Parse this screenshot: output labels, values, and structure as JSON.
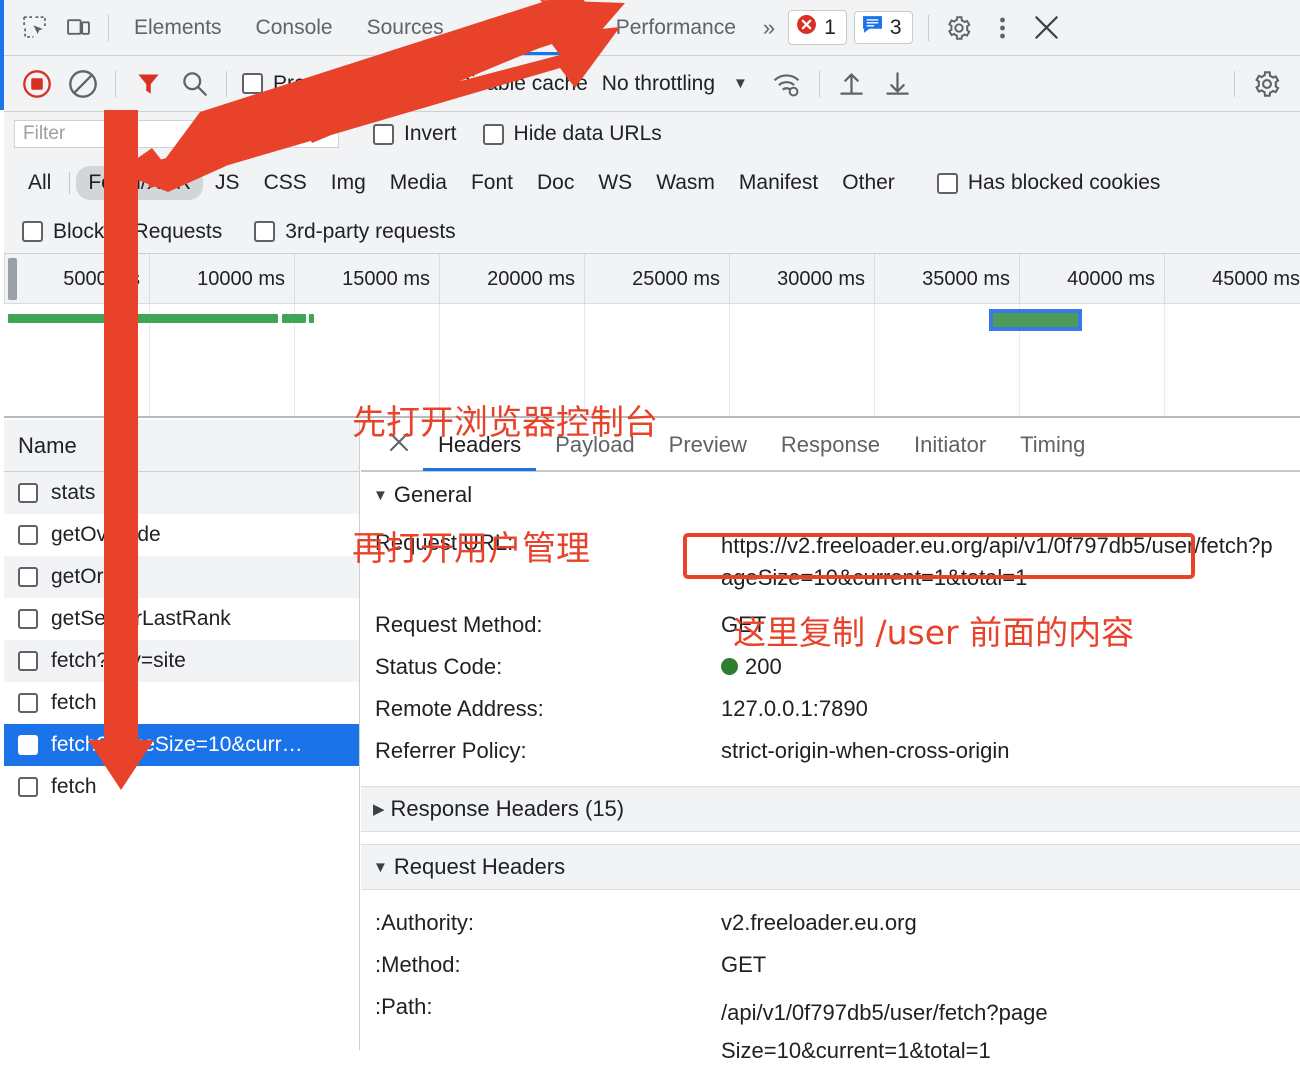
{
  "header": {
    "icons": [
      {
        "name": "inspect-element-icon",
        "glyph": "inspect"
      },
      {
        "name": "device-toolbar-icon",
        "glyph": "device"
      }
    ],
    "tabs": [
      {
        "label": "Elements",
        "active": false,
        "warn": false
      },
      {
        "label": "Console",
        "active": false,
        "warn": false
      },
      {
        "label": "Sources",
        "active": false,
        "warn": false
      },
      {
        "label": "Network",
        "active": true,
        "warn": true
      },
      {
        "label": "Performance",
        "active": false,
        "warn": false
      }
    ],
    "more_tabs": "»",
    "error_count": "1",
    "warning_count": "3",
    "settings_icon": "gear-icon",
    "menu_icon": "kebab-menu-icon",
    "close_icon": "close-icon"
  },
  "toolbar": {
    "record_icon": "record-stop-icon",
    "clear_icon": "clear-icon",
    "filter_icon": "filter-funnel-icon",
    "search_icon": "search-icon",
    "preserve_log": {
      "label": "Preserve log",
      "checked": false
    },
    "disable_cache": {
      "label": "Disable cache",
      "checked": true
    },
    "throttling": "No throttling",
    "throttle_caret": "▼",
    "wifi_icon": "network-conditions-icon",
    "import_icon": "import-har-icon",
    "export_icon": "export-har-icon",
    "settings_icon": "network-settings-gear-icon"
  },
  "filterbar": {
    "placeholder": "Filter",
    "value": "",
    "invert": {
      "label": "Invert",
      "checked": false
    },
    "hide_data_urls": {
      "label": "Hide data URLs",
      "checked": false
    }
  },
  "types": {
    "items": [
      "All",
      "Fetch/XHR",
      "JS",
      "CSS",
      "Img",
      "Media",
      "Font",
      "Doc",
      "WS",
      "Wasm",
      "Manifest",
      "Other"
    ],
    "active": "Fetch/XHR",
    "has_blocked_cookies": {
      "label": "Has blocked cookies",
      "checked": false
    }
  },
  "blockedbar": {
    "blocked_requests": {
      "label": "Blocked Requests",
      "checked": false
    },
    "third_party": {
      "label": "3rd-party requests",
      "checked": false
    }
  },
  "timeline": {
    "ticks": [
      "5000 ms",
      "10000 ms",
      "15000 ms",
      "20000 ms",
      "25000 ms",
      "30000 ms",
      "35000 ms",
      "40000 ms",
      "45000 ms"
    ],
    "green_bar_color": "#41a557",
    "selection_color": "#3b78e7"
  },
  "annotations": {
    "line1": "先打开浏览器控制台",
    "line2": "再打开用户管理",
    "line3": "这里复制 /user 前面的内容",
    "color": "#e8432a"
  },
  "requests": {
    "column_header": "Name",
    "rows": [
      {
        "name": "stats",
        "selected": false
      },
      {
        "name": "getOverride",
        "selected": false
      },
      {
        "name": "getOrder",
        "selected": false
      },
      {
        "name": "getServerLastRank",
        "selected": false
      },
      {
        "name": "fetch?key=site",
        "selected": false
      },
      {
        "name": "fetch",
        "selected": false
      },
      {
        "name": "fetch?pageSize=10&curr…",
        "selected": true
      },
      {
        "name": "fetch",
        "selected": false
      }
    ]
  },
  "details": {
    "close_icon": "close-icon",
    "tabs": [
      {
        "label": "Headers",
        "active": true
      },
      {
        "label": "Payload",
        "active": false
      },
      {
        "label": "Preview",
        "active": false
      },
      {
        "label": "Response",
        "active": false
      },
      {
        "label": "Initiator",
        "active": false
      },
      {
        "label": "Timing",
        "active": false
      }
    ],
    "general": {
      "title": "General",
      "expanded": true,
      "rows": [
        {
          "key": "Request URL:",
          "value": "https://v2.freeloader.eu.org/api/v1/0f797db5/user/fetch?pageSize=10&current=1&total=1"
        },
        {
          "key": "Request Method:",
          "value": "GET"
        },
        {
          "key": "Status Code:",
          "value": "200",
          "status_dot": "green"
        },
        {
          "key": "Remote Address:",
          "value": "127.0.0.1:7890"
        },
        {
          "key": "Referrer Policy:",
          "value": "strict-origin-when-cross-origin"
        }
      ]
    },
    "response_headers": {
      "title": "Response Headers (15)",
      "expanded": false
    },
    "request_headers": {
      "title": "Request Headers",
      "expanded": true,
      "rows": [
        {
          "key": ":Authority:",
          "value": "v2.freeloader.eu.org"
        },
        {
          "key": ":Method:",
          "value": "GET"
        },
        {
          "key": ":Path:",
          "value": "/api/v1/0f797db5/user/fetch?pageSize=10&current=1&total=1"
        }
      ]
    }
  }
}
